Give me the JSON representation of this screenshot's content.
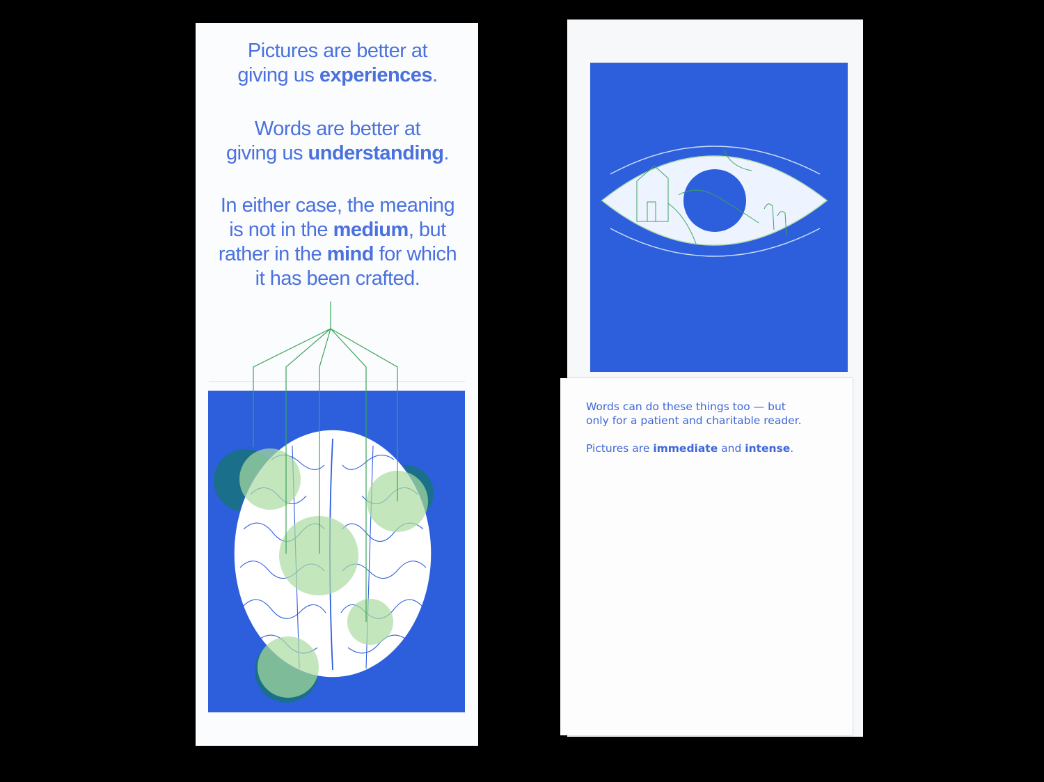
{
  "left_page": {
    "para1": {
      "line1": "Pictures are better at",
      "line2_pre": "giving us ",
      "line2_bold": "experiences",
      "line2_post": "."
    },
    "para2": {
      "line1": "Words are better at",
      "line2_pre": "giving us ",
      "line2_bold": "understanding",
      "line2_post": "."
    },
    "para3": {
      "line1": "In either case, the meaning",
      "line2_pre": "is not in the ",
      "line2_bold": "medium",
      "line2_post": ", but",
      "line3_pre": "rather in the ",
      "line3_bold": "mind",
      "line3_post": " for which",
      "line4": "it has been crafted."
    },
    "illustration": "brain-icon"
  },
  "right_page": {
    "illustration": "eye-icon",
    "p1": {
      "line1": "Words can do these things too — but",
      "line2": "only for a patient and charitable reader."
    },
    "p2": {
      "pre": "Pictures are ",
      "bold1": "immediate",
      "mid": " and ",
      "bold2": "intense",
      "post": "."
    }
  },
  "colors": {
    "blue": "#2d5fdc",
    "text_blue": "#4a71de",
    "green": "#c5e8bc",
    "teal": "#1a7a8a",
    "line_green": "#3aa35a"
  }
}
